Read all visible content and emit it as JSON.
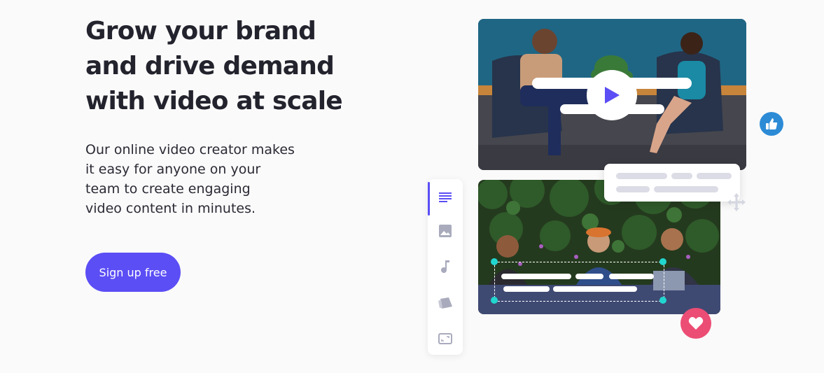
{
  "hero": {
    "headline_line1": "Grow your brand",
    "headline_line2": "and drive demand",
    "headline_line3": "with video at scale",
    "subtext_line1": "Our online video creator makes",
    "subtext_line2": "it easy for anyone on your",
    "subtext_line3": "team to create engaging",
    "subtext_line4": "video content in minutes.",
    "cta_label": "Sign up free"
  },
  "toolbar": {
    "tools": [
      "text-icon",
      "image-icon",
      "music-icon",
      "sticker-icon",
      "resize-icon"
    ],
    "active": "text-icon"
  },
  "colors": {
    "accent": "#5b4ef5",
    "like": "#2d8bd6",
    "heart": "#ec4d74",
    "handle": "#22d6d0"
  }
}
